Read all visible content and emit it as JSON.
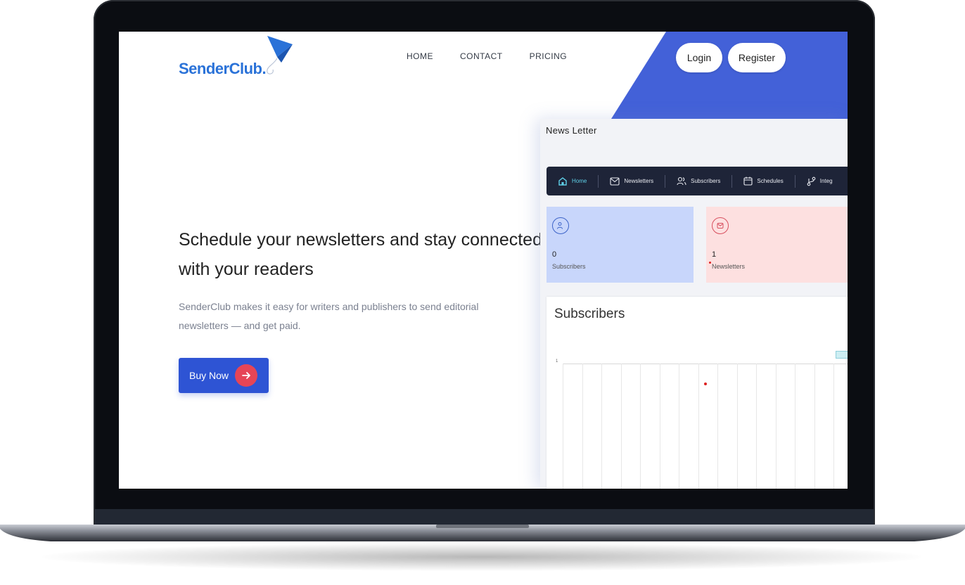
{
  "brand": {
    "name": "SenderClub."
  },
  "nav": {
    "items": [
      "HOME",
      "CONTACT",
      "PRICING"
    ]
  },
  "auth": {
    "login": "Login",
    "register": "Register"
  },
  "hero": {
    "title": "Schedule your newsletters and stay connected with your readers",
    "subtitle": "SenderClub makes it easy for writers and publishers to send editorial newsletters — and get paid.",
    "cta": "Buy Now"
  },
  "dashboard": {
    "title": "News Letter",
    "tabs": [
      {
        "label": "Home",
        "icon": "home-icon",
        "active": true
      },
      {
        "label": "Newsletters",
        "icon": "mail-icon",
        "active": false
      },
      {
        "label": "Subscribers",
        "icon": "users-icon",
        "active": false
      },
      {
        "label": "Schedules",
        "icon": "calendar-icon",
        "active": false
      },
      {
        "label": "Integ",
        "icon": "integrations-icon",
        "active": false
      }
    ],
    "cards": {
      "subscribers": {
        "value": "0",
        "label": "Subscribers",
        "color": "#c8d6fb"
      },
      "newsletters": {
        "value": "1",
        "label": "Newsletters",
        "color": "#fde0e0"
      }
    },
    "chart": {
      "title": "Subscribers",
      "y_tick": "1"
    }
  },
  "colors": {
    "accent_blue": "#4361d8",
    "button_blue": "#2e54d4",
    "arrow_red": "#e64556",
    "nav_dark": "#1e2438",
    "active_tab": "#5fd0e8",
    "brand_blue": "#2a72d8"
  }
}
